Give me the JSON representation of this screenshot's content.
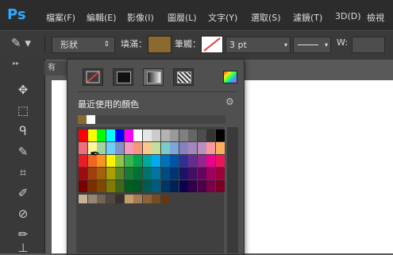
{
  "app": {
    "logo": "Ps"
  },
  "menu": [
    "檔案(F)",
    "編輯(E)",
    "影像(I)",
    "圖層(L)",
    "文字(Y)",
    "選取(S)",
    "濾鏡(T)",
    "3D(D)",
    "檢視"
  ],
  "options": {
    "shape_mode": "形狀",
    "fill_label": "填滿：",
    "stroke_label": "筆觸：",
    "stroke_size": "3 pt",
    "width_label": "W:",
    "fill_color": "#8a6a2e"
  },
  "doc": {
    "tab_label": "有"
  },
  "popup": {
    "recent_title": "最近使用的顏色",
    "recent_colors": [
      "#8a6a2e",
      "#ffffff"
    ],
    "swatch_rows": [
      [
        "#ff0000",
        "#ffff00",
        "#00ff00",
        "#00ffff",
        "#0000ff",
        "#ff00ff",
        "#ffffff",
        "#e6e6e6",
        "#cccccc",
        "#b3b3b3",
        "#999999",
        "#808080",
        "#666666",
        "#4d4d4d",
        "#333333",
        "#000000"
      ],
      [
        "#f26d7d",
        "#fff799",
        "#a3d39c",
        "#6dcff6",
        "#8393ca",
        "#f49ac1",
        "#f7977a",
        "#fdc68a",
        "#c4df9b",
        "#7accc8",
        "#7da7d9",
        "#8781bd",
        "#a187be",
        "#bc8dbf",
        "#f6989d",
        "#fbaf5d"
      ],
      [
        "#ed1c24",
        "#f26522",
        "#f7941d",
        "#fff200",
        "#8dc63f",
        "#39b54a",
        "#00a651",
        "#00a99d",
        "#00aeef",
        "#0072bc",
        "#0054a6",
        "#2e3192",
        "#662d91",
        "#92278f",
        "#ec008c",
        "#ed145b"
      ],
      [
        "#9e0b0f",
        "#a0410d",
        "#a36209",
        "#aba000",
        "#598527",
        "#197b30",
        "#007236",
        "#00746b",
        "#0076a3",
        "#004b80",
        "#003471",
        "#1b1464",
        "#440e62",
        "#630460",
        "#9e005d",
        "#9e0039"
      ],
      [
        "#790000",
        "#7b2e00",
        "#7d4900",
        "#827b00",
        "#406618",
        "#005e20",
        "#005826",
        "#005952",
        "#005b7f",
        "#003663",
        "#002157",
        "#0d004c",
        "#32004b",
        "#4b0049",
        "#7b0046",
        "#7a0026"
      ],
      [
        "#c7b299",
        "#998675",
        "#736357",
        "#534741",
        "#37302d",
        "#c69c6d",
        "#a67c52",
        "#8c6239",
        "#754c24",
        "#603913"
      ]
    ],
    "colors": {
      "stroke_red": "#e23b3b"
    }
  }
}
